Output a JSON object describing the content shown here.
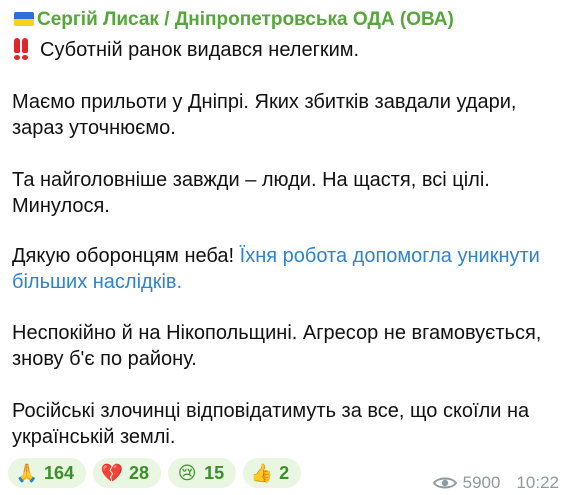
{
  "channel": {
    "sender_name": "Сергій Лисак / Дніпропетровська ОДА (ОВА)",
    "flag_colors": [
      "#2f6ed6",
      "#f7d11a"
    ],
    "sender_color": "#57a63c"
  },
  "message": {
    "line1": "Суботній ранок видався нелегким.",
    "line2": "Маємо прильоти у Дніпрі. Яких збитків завдали удари,",
    "line3": "зараз уточнюємо.",
    "line4": "Та найголовніше завжди – люди. На щастя, всі цілі.",
    "line5": "Минулося.",
    "line6_text": "Дякую оборонцям неба! ",
    "line6_link": "Їхня робота допомогла уникнути",
    "line7_link": "більших наслідків.",
    "line8": "Неспокійно й на Нікопольщині. Агресор не вгамовується,",
    "line9": "знову б'є по району.",
    "line10": "Російські злочинці відповідатимуть за все, що скоїли на",
    "line11": "українській землі.",
    "link_color": "#2f83cc",
    "alert_icon": "double-exclamation-icon"
  },
  "reactions": [
    {
      "icon": "folded-hands-icon",
      "emoji": "🙏",
      "count": "164"
    },
    {
      "icon": "broken-heart-icon",
      "emoji": "💔",
      "count": "28"
    },
    {
      "icon": "crying-face-icon",
      "emoji": "😢",
      "count": "15"
    },
    {
      "icon": "thumbs-up-icon",
      "emoji": "👍",
      "count": "2"
    }
  ],
  "meta": {
    "views": "5900",
    "time": "10:22",
    "views_icon": "eye-icon"
  }
}
